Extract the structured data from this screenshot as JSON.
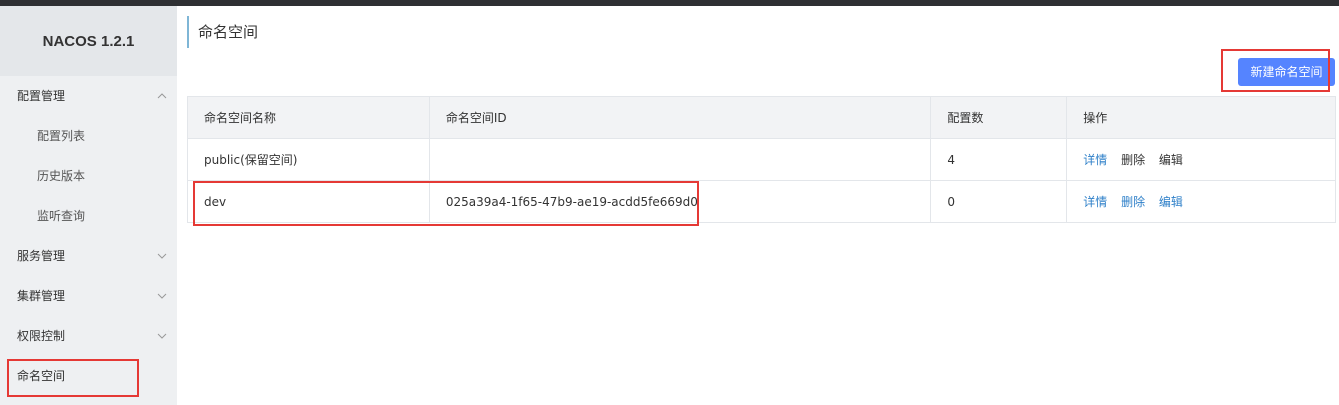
{
  "brand": {
    "title": "NACOS 1.2.1"
  },
  "sidebar": {
    "items": [
      {
        "label": "配置管理",
        "type": "group",
        "chevron": "up"
      },
      {
        "label": "配置列表",
        "type": "sub"
      },
      {
        "label": "历史版本",
        "type": "sub"
      },
      {
        "label": "监听查询",
        "type": "sub"
      },
      {
        "label": "服务管理",
        "type": "group",
        "chevron": "down"
      },
      {
        "label": "集群管理",
        "type": "group",
        "chevron": "down"
      },
      {
        "label": "权限控制",
        "type": "group",
        "chevron": "down"
      },
      {
        "label": "命名空间",
        "type": "group",
        "active": true
      }
    ]
  },
  "main": {
    "title": "命名空间",
    "new_button_label": "新建命名空间"
  },
  "table": {
    "headers": [
      "命名空间名称",
      "命名空间ID",
      "配置数",
      "操作"
    ],
    "rows": [
      {
        "name": "public(保留空间)",
        "id": "",
        "count": "4",
        "ops": [
          "详情",
          "删除",
          "编辑"
        ]
      },
      {
        "name": "dev",
        "id": "025a39a4-1f65-47b9-ae19-acdd5fe669d0",
        "count": "0",
        "ops": [
          "详情",
          "删除",
          "编辑"
        ]
      }
    ]
  },
  "colors": {
    "accent": "#5584ff",
    "link": "#2f80c9",
    "highlight": "#e53935",
    "sidebar_bg": "#eef0f2"
  }
}
